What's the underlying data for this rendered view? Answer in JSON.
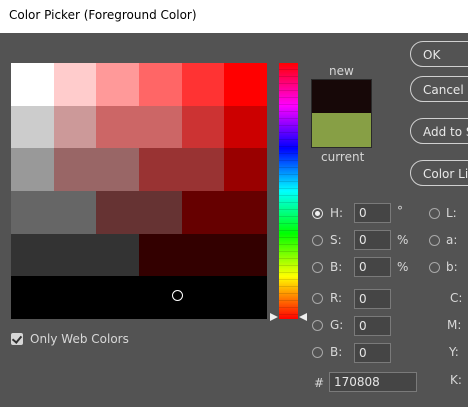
{
  "window": {
    "title": "Color Picker (Foreground Color)"
  },
  "swatches": {
    "new_label": "new",
    "current_label": "current",
    "new_color": "#170808",
    "current_color": "#879f45"
  },
  "buttons": {
    "ok": "OK",
    "cancel": "Cancel",
    "add_to_swatches": "Add to Swatches",
    "color_libraries": "Color Libraries"
  },
  "hsb": [
    {
      "label": "H:",
      "value": "0",
      "unit": "°",
      "selected": true
    },
    {
      "label": "S:",
      "value": "0",
      "unit": "%",
      "selected": false
    },
    {
      "label": "B:",
      "value": "0",
      "unit": "%",
      "selected": false
    }
  ],
  "rgb": [
    {
      "label": "R:",
      "value": "0"
    },
    {
      "label": "G:",
      "value": "0"
    },
    {
      "label": "B:",
      "value": "0"
    }
  ],
  "lab": [
    {
      "label": "L:"
    },
    {
      "label": "a:"
    },
    {
      "label": "b:"
    }
  ],
  "cmyk": [
    {
      "label": "C:"
    },
    {
      "label": "M:"
    },
    {
      "label": "Y:"
    },
    {
      "label": "K:"
    }
  ],
  "hex": {
    "label": "#",
    "value": "170808"
  },
  "only_web_colors": {
    "label": "Only Web Colors",
    "checked": true
  }
}
